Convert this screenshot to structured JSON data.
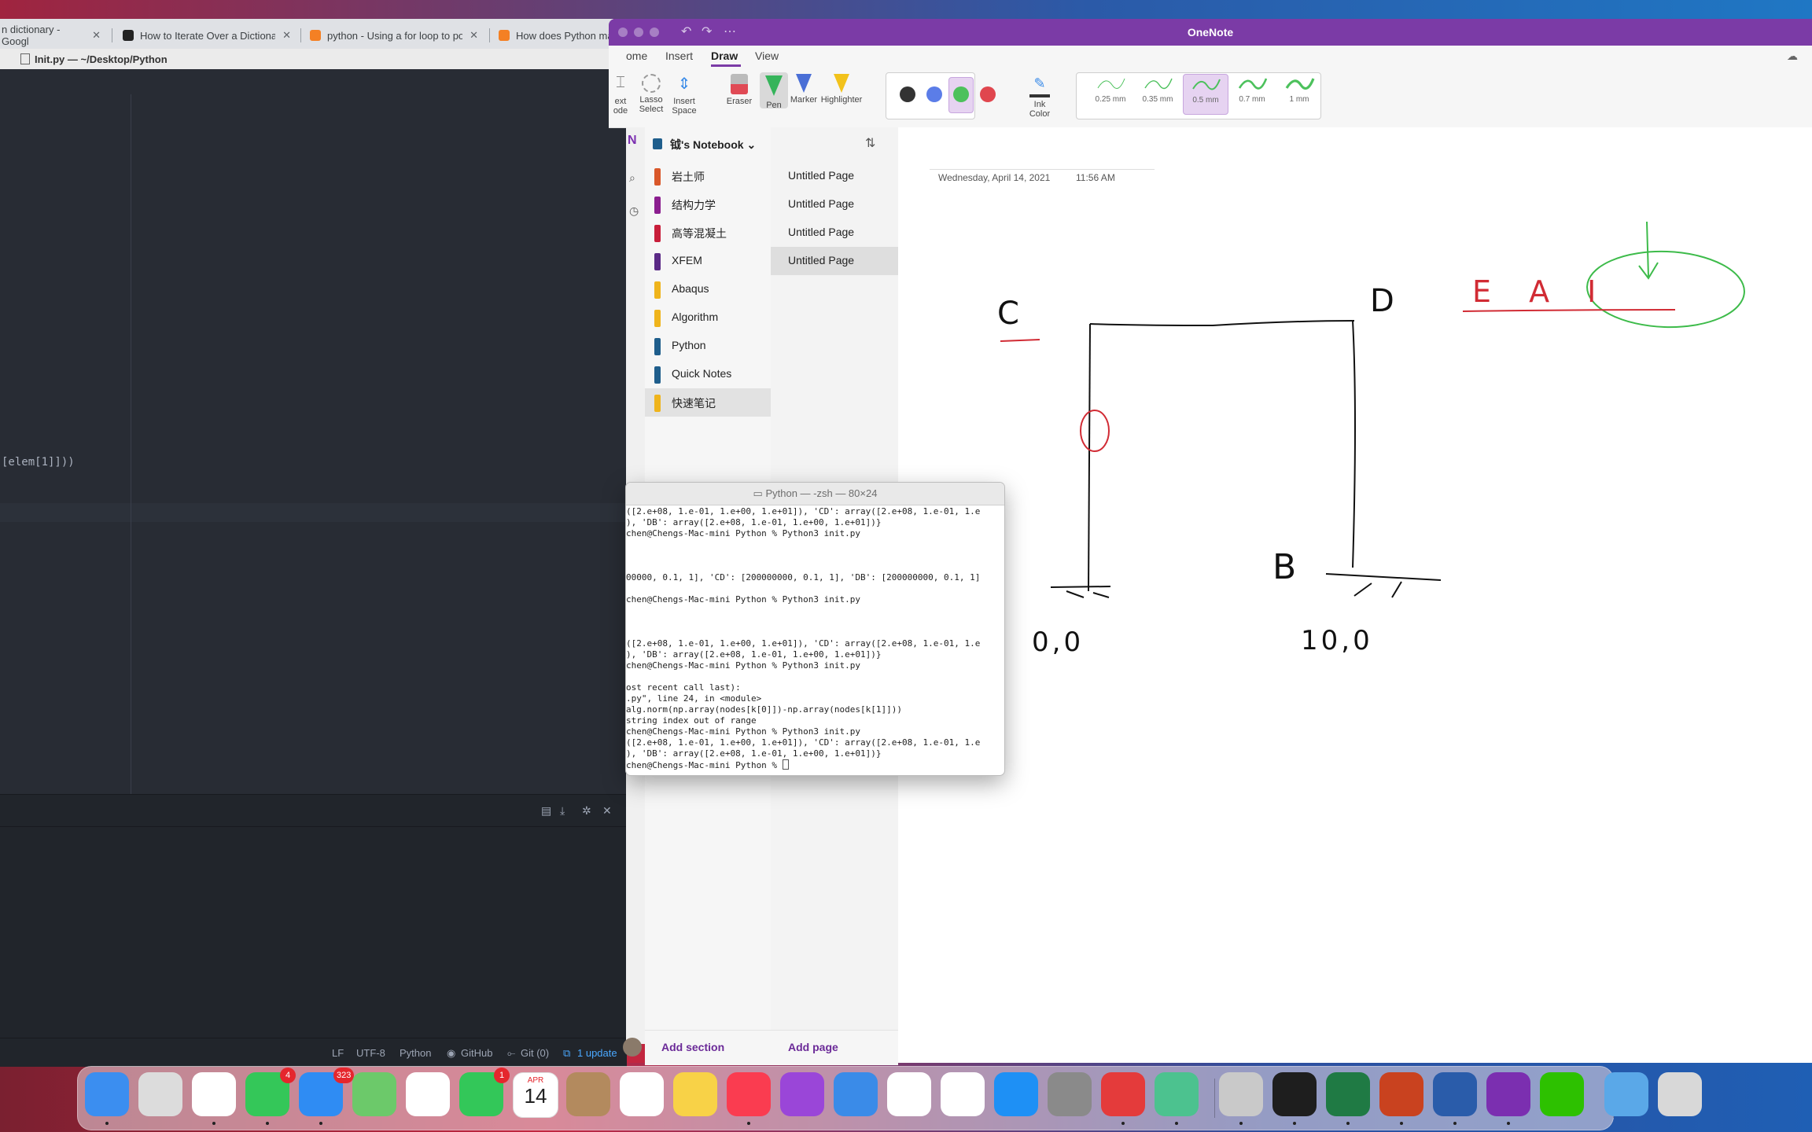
{
  "browser": {
    "tabs": [
      {
        "title": "n dictionary - Googl",
        "favicon": "google"
      },
      {
        "title": "How to Iterate Over a Dictiona",
        "favicon": "sx"
      },
      {
        "title": "python - Using a for loop to po",
        "favicon": "stackoverflow"
      },
      {
        "title": "How does Python ma",
        "favicon": "stackoverflow"
      }
    ]
  },
  "atom": {
    "window_title": "Init.py — ~/Desktop/Python",
    "code_fragment": "[elem[1]]))",
    "status": {
      "line_ending": "LF",
      "encoding": "UTF-8",
      "grammar": "Python",
      "github": "GitHub",
      "git": "Git (0)",
      "update": "1 update"
    }
  },
  "onenote": {
    "app_title": "OneNote",
    "tabs": [
      "ome",
      "Insert",
      "Draw",
      "View"
    ],
    "active_tab": "Draw",
    "ribbon": {
      "tools": [
        {
          "label1": "ext",
          "label2": "ode"
        },
        {
          "label1": "Lasso",
          "label2": "Select"
        },
        {
          "label1": "Insert",
          "label2": "Space"
        },
        {
          "label1": "Eraser",
          "label2": ""
        },
        {
          "label1": "Pen",
          "label2": ""
        },
        {
          "label1": "Marker",
          "label2": ""
        },
        {
          "label1": "Highlighter",
          "label2": ""
        }
      ],
      "colors": [
        "#333333",
        "#5b7de8",
        "#4cc15c",
        "#e0464e"
      ],
      "selected_color": "#4cc15c",
      "ink_color": {
        "label1": "Ink",
        "label2": "Color"
      },
      "thickness": [
        "0.25 mm",
        "0.35 mm",
        "0.5 mm",
        "0.7 mm",
        "1 mm"
      ],
      "selected_thickness": "0.5 mm"
    },
    "notebook": "钺's Notebook",
    "sections": [
      {
        "name": "岩土师",
        "color": "#d9582a"
      },
      {
        "name": "结构力学",
        "color": "#8b1e8f"
      },
      {
        "name": "高等混凝土",
        "color": "#c81e3a"
      },
      {
        "name": "XFEM",
        "color": "#5b2a86"
      },
      {
        "name": "Abaqus",
        "color": "#efb41c"
      },
      {
        "name": "Algorithm",
        "color": "#efb41c"
      },
      {
        "name": "Python",
        "color": "#1f5e8c"
      },
      {
        "name": "Quick Notes",
        "color": "#1f5e8c"
      },
      {
        "name": "快速笔记",
        "color": "#efb41c"
      }
    ],
    "selected_section": "快速笔记",
    "pages": [
      "Untitled Page",
      "Untitled Page",
      "Untitled Page",
      "Untitled Page"
    ],
    "selected_page_index": 3,
    "add_section": "Add section",
    "add_page": "Add page",
    "page_date": "Wednesday, April 14, 2021",
    "page_time": "11:56 AM",
    "ink_labels": [
      "C",
      "D",
      "B",
      "E A I",
      "0,0",
      "10,0"
    ]
  },
  "terminal": {
    "title": "Python — -zsh — 80×24",
    "lines": [
      "([2.e+08, 1.e-01, 1.e+00, 1.e+01]), 'CD': array([2.e+08, 1.e-01, 1.e",
      "), 'DB': array([2.e+08, 1.e-01, 1.e+00, 1.e+01])}",
      "chen@Chengs-Mac-mini Python % Python3 init.py",
      "",
      "",
      "",
      "00000, 0.1, 1], 'CD': [200000000, 0.1, 1], 'DB': [200000000, 0.1, 1]",
      "",
      "chen@Chengs-Mac-mini Python % Python3 init.py",
      "",
      "",
      "",
      "([2.e+08, 1.e-01, 1.e+00, 1.e+01]), 'CD': array([2.e+08, 1.e-01, 1.e",
      "), 'DB': array([2.e+08, 1.e-01, 1.e+00, 1.e+01])}",
      "chen@Chengs-Mac-mini Python % Python3 init.py",
      "",
      "ost recent call last):",
      ".py\", line 24, in <module>",
      "alg.norm(np.array(nodes[k[0]])-np.array(nodes[k[1]]))",
      "string index out of range",
      "chen@Chengs-Mac-mini Python % Python3 init.py",
      "([2.e+08, 1.e-01, 1.e+00, 1.e+01]), 'CD': array([2.e+08, 1.e-01, 1.e",
      "), 'DB': array([2.e+08, 1.e-01, 1.e+00, 1.e+01])}",
      "chen@Chengs-Mac-mini Python % "
    ]
  },
  "dock": {
    "apps": [
      {
        "name": "Finder",
        "icon": "finder-icon",
        "color": "#3b8ef0",
        "running": true
      },
      {
        "name": "Launchpad",
        "icon": "launchpad-icon",
        "color": "#dcdcdc",
        "running": false
      },
      {
        "name": "Chrome",
        "icon": "chrome-icon",
        "color": "#ffffff",
        "running": true
      },
      {
        "name": "Messages",
        "icon": "messages-icon",
        "color": "#34c759",
        "running": true,
        "badge": "4"
      },
      {
        "name": "Mail",
        "icon": "mail-icon",
        "color": "#2f8cf3",
        "running": true,
        "badge": "323"
      },
      {
        "name": "Maps",
        "icon": "maps-icon",
        "color": "#6cc96a",
        "running": false
      },
      {
        "name": "Photos",
        "icon": "photos-icon",
        "color": "#ffffff",
        "running": false
      },
      {
        "name": "FaceTime",
        "icon": "facetime-icon",
        "color": "#33c759",
        "running": false,
        "badge": "1"
      },
      {
        "name": "Calendar",
        "icon": "calendar-icon",
        "color": "#ffffff",
        "running": false,
        "month": "APR",
        "day": "14"
      },
      {
        "name": "Contacts",
        "icon": "contacts-icon",
        "color": "#b38a5e",
        "running": false
      },
      {
        "name": "Reminders",
        "icon": "reminders-icon",
        "color": "#ffffff",
        "running": false
      },
      {
        "name": "Notes",
        "icon": "notes-icon",
        "color": "#f8d247",
        "running": false
      },
      {
        "name": "Music",
        "icon": "music-icon",
        "color": "#fa3c50",
        "running": true
      },
      {
        "name": "Podcasts",
        "icon": "podcasts-icon",
        "color": "#9a46d8",
        "running": false
      },
      {
        "name": "Keynote",
        "icon": "keynote-icon",
        "color": "#3a8be8",
        "running": false
      },
      {
        "name": "Numbers",
        "icon": "numbers-icon",
        "color": "#ffffff",
        "running": false
      },
      {
        "name": "Pages",
        "icon": "pages-icon",
        "color": "#ffffff",
        "running": false
      },
      {
        "name": "App Store",
        "icon": "appstore-icon",
        "color": "#1e90f5",
        "running": false
      },
      {
        "name": "System Preferences",
        "icon": "settings-icon",
        "color": "#8a8a8a",
        "running": false
      },
      {
        "name": "Parallels",
        "icon": "parallels-icon",
        "color": "#e43b3b",
        "running": true
      },
      {
        "name": "Atom",
        "icon": "atom-icon",
        "color": "#4cc28f",
        "running": true
      },
      {
        "name": "Superstar",
        "icon": "star-icon",
        "color": "#c9c9c9",
        "running": true
      },
      {
        "name": "Terminal",
        "icon": "terminal-icon",
        "color": "#1e1e1e",
        "running": true
      },
      {
        "name": "Excel",
        "icon": "excel-icon",
        "color": "#1f7a44",
        "running": true
      },
      {
        "name": "PowerPoint",
        "icon": "powerpoint-icon",
        "color": "#c9421f",
        "running": true
      },
      {
        "name": "Word",
        "icon": "word-icon",
        "color": "#2a5caa",
        "running": true
      },
      {
        "name": "OneNote",
        "icon": "onenote-icon",
        "color": "#7b2fb0",
        "running": true
      },
      {
        "name": "WeChat",
        "icon": "wechat-icon",
        "color": "#2dc100",
        "running": false
      },
      {
        "name": "Downloads",
        "icon": "downloads-folder-icon",
        "color": "#5aa8e8",
        "running": false
      },
      {
        "name": "Trash",
        "icon": "trash-icon",
        "color": "#d8d8d8",
        "running": false
      }
    ]
  }
}
